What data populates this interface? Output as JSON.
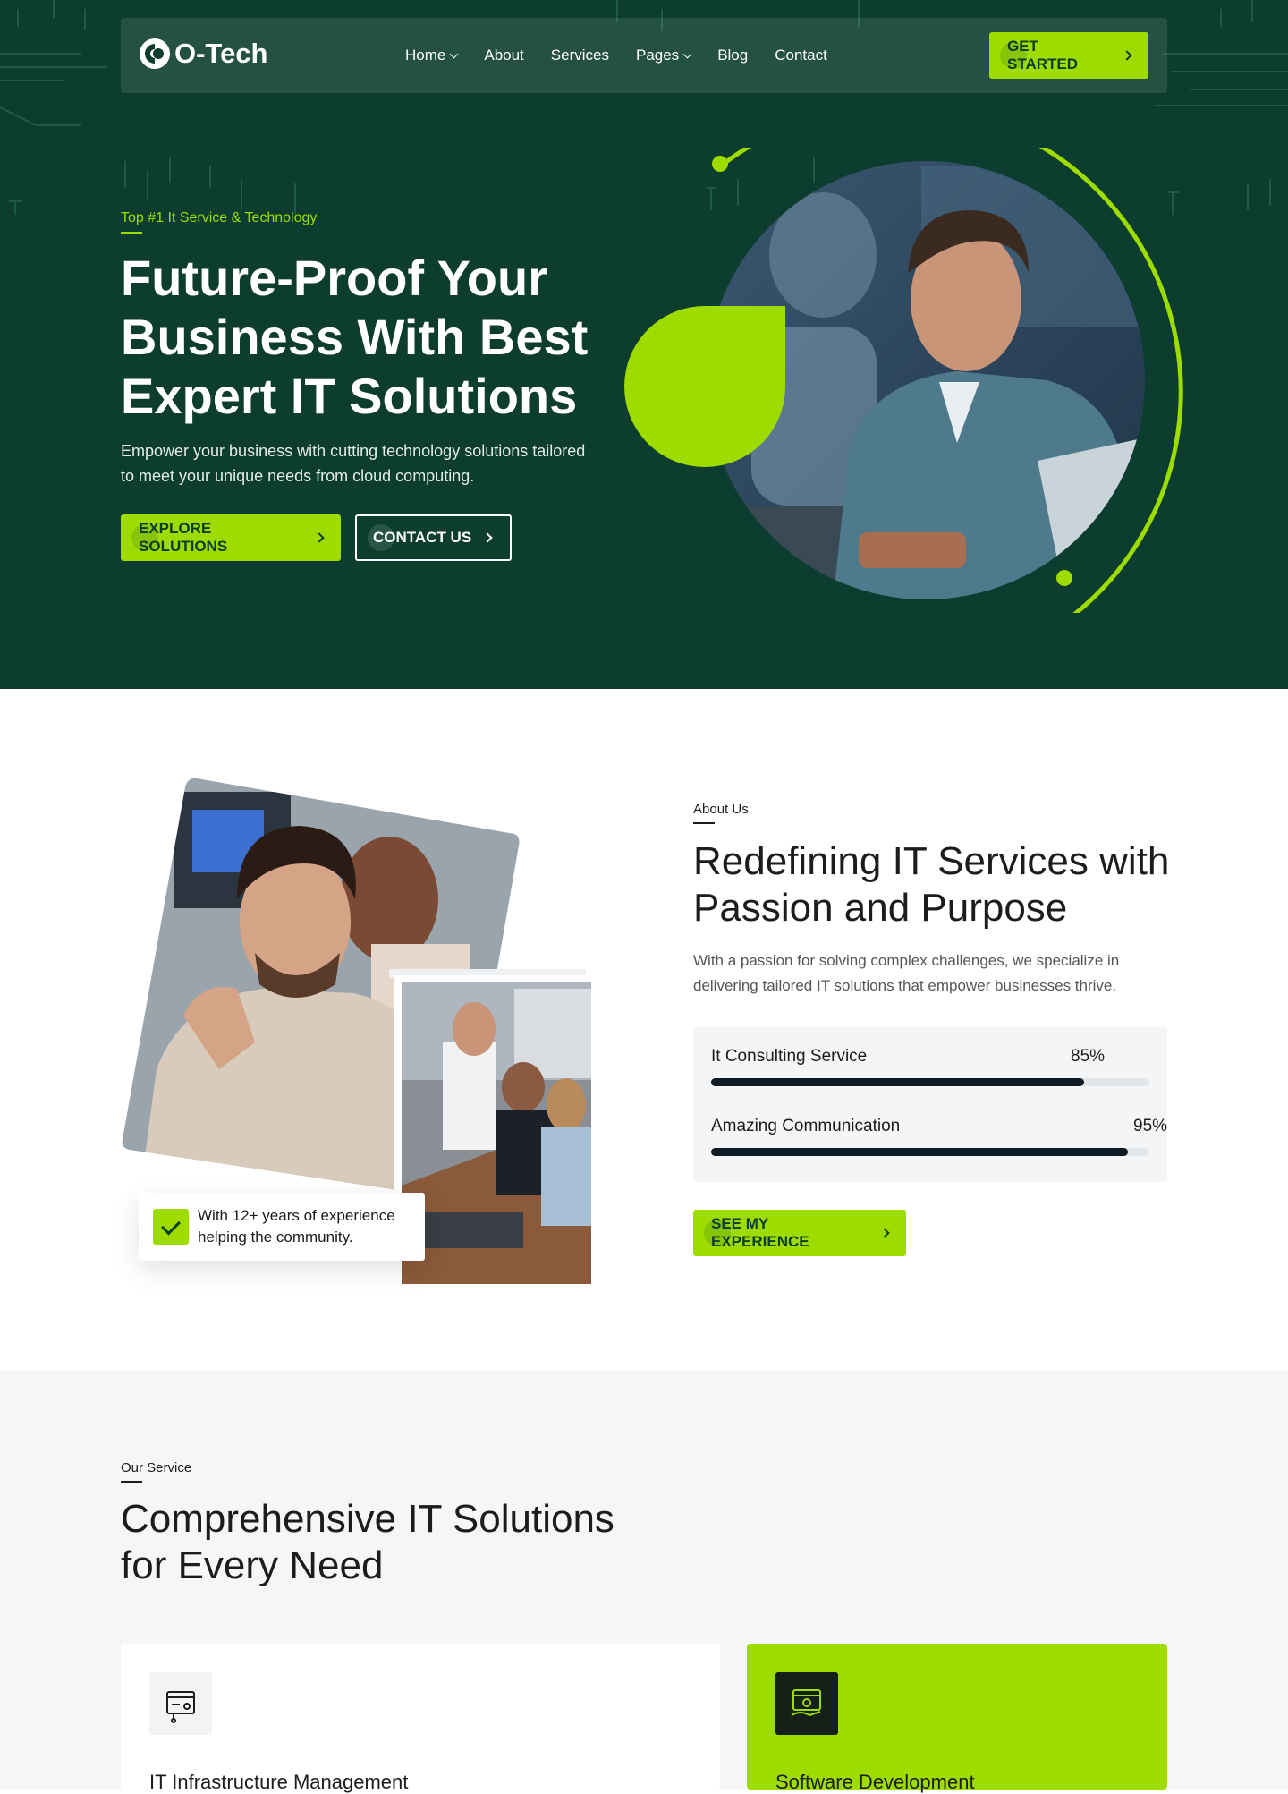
{
  "nav": {
    "brand": "O-Tech",
    "items": [
      {
        "label": "Home",
        "dropdown": true
      },
      {
        "label": "About",
        "dropdown": false
      },
      {
        "label": "Services",
        "dropdown": false
      },
      {
        "label": "Pages",
        "dropdown": true
      },
      {
        "label": "Blog",
        "dropdown": false
      },
      {
        "label": "Contact",
        "dropdown": false
      }
    ],
    "cta": "GET STARTED"
  },
  "hero": {
    "eyebrow": "Top #1 It Service & Technology",
    "title": "Future-Proof Your Business With Best Expert IT Solutions",
    "description": "Empower your business with cutting technology solutions tailored to meet your unique needs from cloud computing.",
    "primary_button": "EXPLORE SOLUTIONS",
    "secondary_button": "CONTACT US"
  },
  "about": {
    "eyebrow": "About Us",
    "title": "Redefining IT Services with Passion and Purpose",
    "description": "With a passion for solving complex challenges, we specialize in delivering tailored IT solutions that empower businesses thrive.",
    "experience_badge": "With 12+ years of experience helping the community.",
    "skills": [
      {
        "name": "It Consulting Service",
        "value_label": "85%",
        "percent": 85
      },
      {
        "name": "Amazing Communication",
        "value_label": "95%",
        "percent": 95
      }
    ],
    "button": "SEE MY EXPERIENCE"
  },
  "services": {
    "eyebrow": "Our Service",
    "title": "Comprehensive IT Solutions for Every Need",
    "cards": [
      {
        "title": "IT Infrastructure Management",
        "icon": "server-icon"
      },
      {
        "title": "Software Development",
        "icon": "software-icon"
      }
    ]
  },
  "colors": {
    "dark_green": "#0d3d2f",
    "lime": "#9edc00",
    "light_gray": "#f4f6f7",
    "text": "#1c1c1c"
  }
}
